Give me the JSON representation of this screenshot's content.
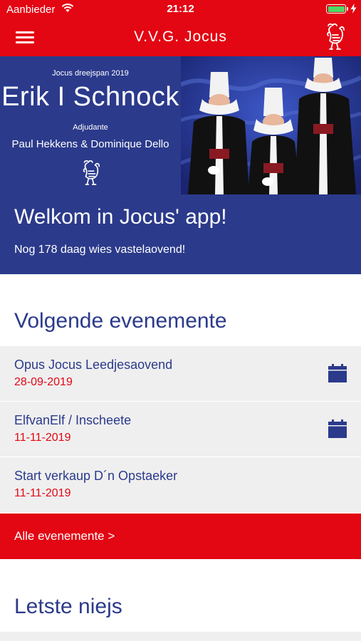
{
  "status_bar": {
    "carrier": "Aanbieder",
    "time": "21:12"
  },
  "nav": {
    "title": "V.V.G. Jocus",
    "menu_icon": "hamburger-menu-icon",
    "logo_icon": "rooster-logo-icon"
  },
  "hero": {
    "subtitle": "Jocus dreejspan 2019",
    "name": "Erik I Schnock",
    "adjutant_label": "Adjudante",
    "adjutants": "Paul Hekkens & Dominique Dello",
    "welcome": "Welkom in Jocus' app!",
    "countdown": "Nog 178 daag wies vastelaovend!"
  },
  "events_section": {
    "title": "Volgende evenemente",
    "items": [
      {
        "title": "Opus Jocus Leedjesaovend",
        "date": "28-09-2019",
        "has_calendar": true
      },
      {
        "title": "ElfvanElf / Inscheete",
        "date": "11-11-2019",
        "has_calendar": true
      },
      {
        "title": "Start verkaup D´n Opstaeker",
        "date": "11-11-2019",
        "has_calendar": false
      }
    ],
    "all_label": "Alle evenemente >"
  },
  "news_section": {
    "title": "Letste niejs"
  },
  "colors": {
    "brand_red": "#e30613",
    "brand_blue": "#2b3a8b",
    "row_bg": "#efefef"
  }
}
